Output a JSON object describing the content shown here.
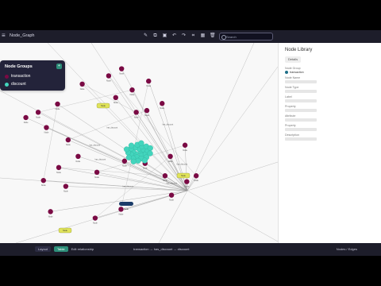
{
  "app": {
    "title": "Node_Graph",
    "menu_icon": "menu-icon",
    "toolbar_icons": [
      "edit-icon",
      "copy-icon",
      "image-icon",
      "undo-icon",
      "redo-icon",
      "crop-icon",
      "grid-icon",
      "delete-icon"
    ],
    "search": {
      "placeholder": "Search"
    }
  },
  "node_groups": {
    "header": "Node Groups",
    "add_button": "+",
    "items": [
      {
        "label": "transaction",
        "color": "#7a0a44"
      },
      {
        "label": "discount",
        "color": "#43d5bd"
      }
    ]
  },
  "sidebar": {
    "title": "Node Library",
    "tab": "Details",
    "fields": [
      {
        "label": "Node Group",
        "value": "transaction",
        "checked": true
      },
      {
        "label": "Node Name",
        "value": "Field"
      },
      {
        "label": "Node Type",
        "value": "Field"
      },
      {
        "label": "Label",
        "value": "Field"
      },
      {
        "label": "Property",
        "value": "Field"
      },
      {
        "label": "Attribute",
        "value": "Field"
      },
      {
        "label": "Property",
        "value": "Field"
      },
      {
        "label": "Description",
        "value": "Field"
      }
    ]
  },
  "footer": {
    "left_labels": [
      "Layout",
      "Table",
      "Edit relationship"
    ],
    "middle": "transaction ↔ has_discount ↔ discount",
    "right": "Nodes / Edges"
  },
  "graph": {
    "center_cluster_label": "discount",
    "edge_label": "has_discount",
    "colors": {
      "transaction": "#7a0a44",
      "discount": "#43d5bd",
      "edge": "#9a9a9a",
      "highlight": "#e0e35a",
      "selected": "#1b3c69"
    },
    "transaction_nodes": [
      {
        "label": "Node"
      },
      {
        "label": "Node"
      },
      {
        "label": "Node"
      },
      {
        "label": "Node"
      },
      {
        "label": "Node"
      },
      {
        "label": "Node"
      },
      {
        "label": "Node"
      },
      {
        "label": "Node"
      },
      {
        "label": "Node"
      },
      {
        "label": "Node"
      },
      {
        "label": "Node"
      },
      {
        "label": "Node"
      },
      {
        "label": "Node"
      },
      {
        "label": "Node"
      },
      {
        "label": "Node"
      },
      {
        "label": "Node"
      },
      {
        "label": "Node"
      },
      {
        "label": "Node"
      },
      {
        "label": "Node"
      },
      {
        "label": "Node"
      },
      {
        "label": "Node"
      },
      {
        "label": "Node"
      },
      {
        "label": "Node"
      },
      {
        "label": "Node"
      },
      {
        "label": "Node"
      },
      {
        "label": "Node"
      },
      {
        "label": "Node"
      },
      {
        "label": "Node"
      },
      {
        "label": "Node"
      },
      {
        "label": "Node"
      }
    ],
    "highlight_labels": [
      "Node",
      "Node",
      "Node"
    ],
    "selected_label": "Node"
  }
}
